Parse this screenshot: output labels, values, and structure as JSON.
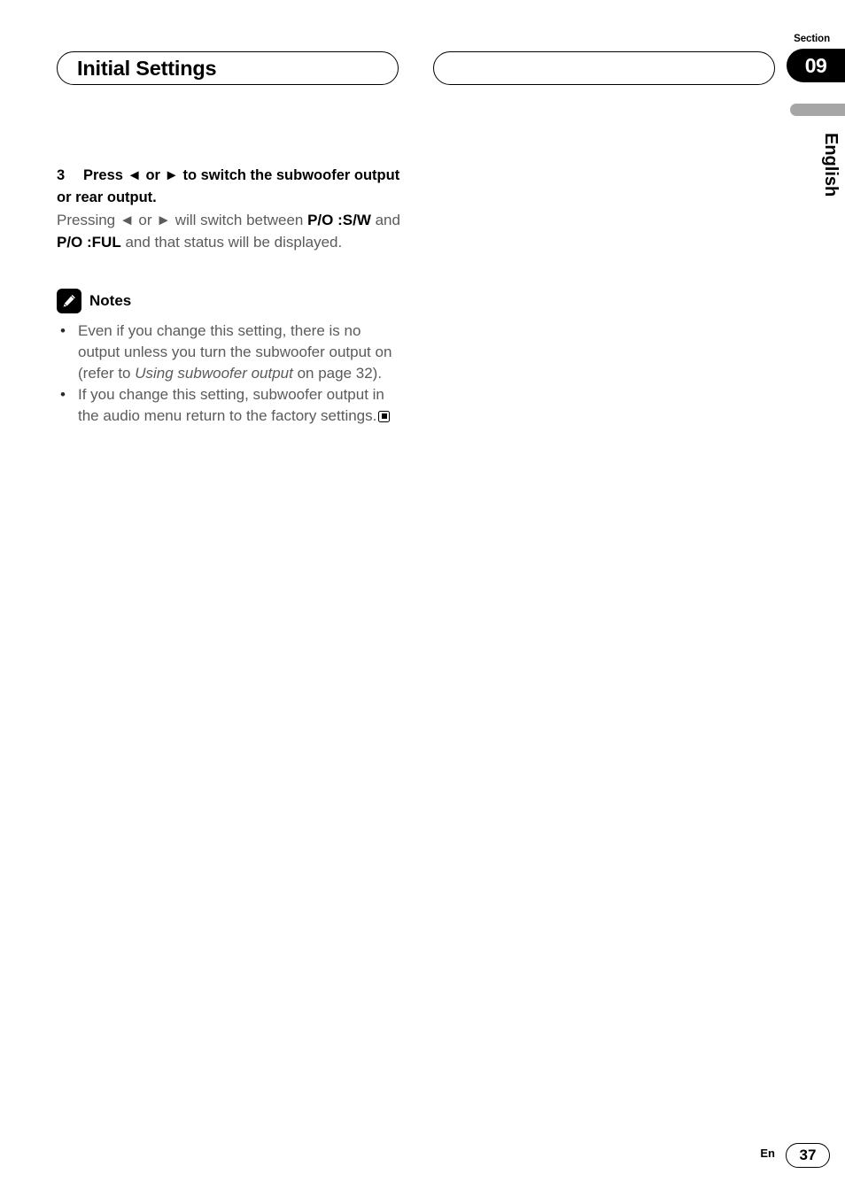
{
  "header": {
    "left_pill_title": "Initial Settings",
    "right_pill_title": "",
    "section_label": "Section",
    "section_number": "09",
    "language_tab": "English"
  },
  "main": {
    "step": {
      "number": "3",
      "heading": "Press ◄ or ► to switch the subwoofer output or rear output."
    },
    "paragraph": {
      "part1": "Pressing ◄ or ► will switch between ",
      "bold1": "P/O :S/W",
      "part2": " and ",
      "bold2": "P/O :FUL",
      "part3": " and that status will be displayed."
    },
    "notes": {
      "icon": "pencil-icon",
      "title": "Notes",
      "items": [
        {
          "part1": "Even if you change this setting, there is no output unless you turn the subwoofer output on (refer to ",
          "italic": "Using subwoofer output",
          "part2": " on page 32)."
        },
        {
          "part1": "If you change this setting, subwoofer output in the audio menu return to the factory settings.",
          "italic": "",
          "part2": ""
        }
      ]
    }
  },
  "footer": {
    "language_code": "En",
    "page_number": "37"
  },
  "colors": {
    "accent_black": "#000000",
    "body_gray": "#5b5b5b",
    "bar_gray": "#a6a6a6"
  }
}
